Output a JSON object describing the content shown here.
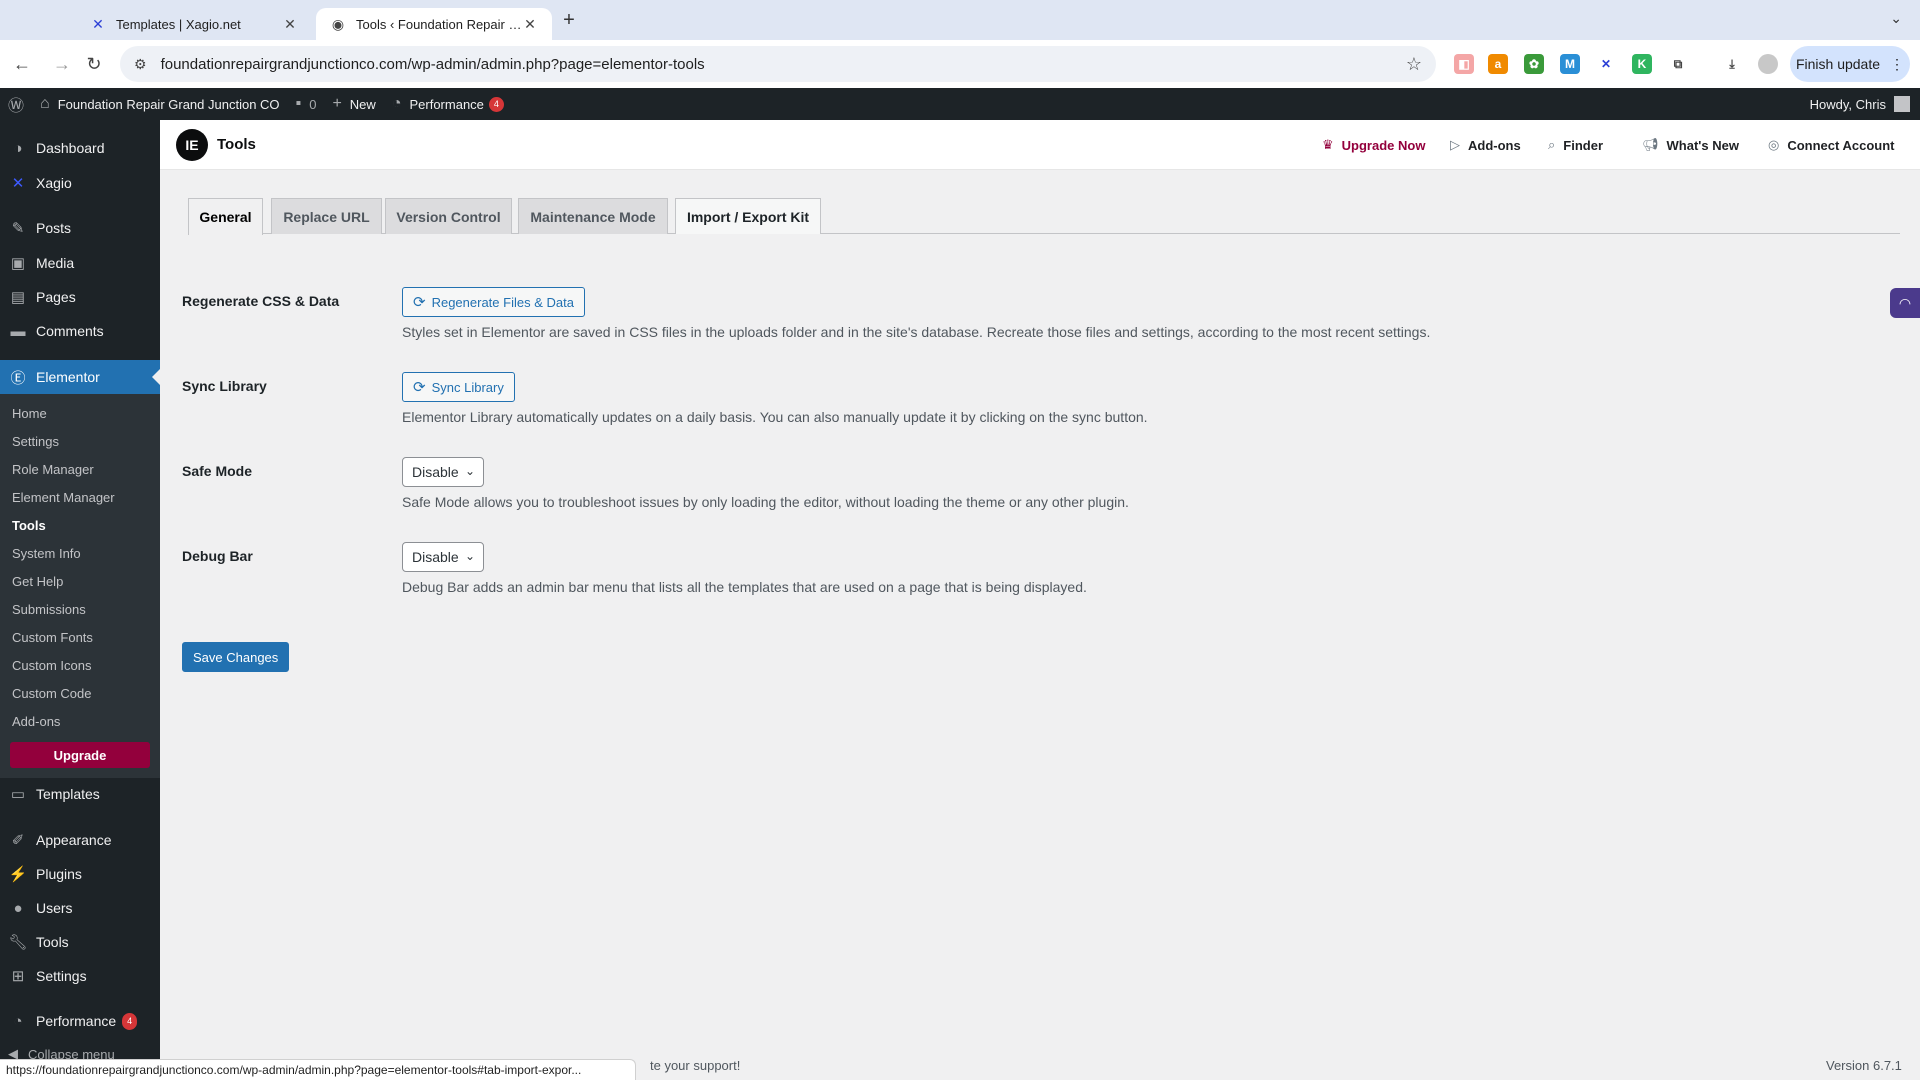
{
  "browser": {
    "tabs": [
      {
        "title": "Templates | Xagio.net",
        "icon": "xagio-icon"
      },
      {
        "title": "Tools ‹ Foundation Repair Gra",
        "icon": "wordpress-icon"
      }
    ],
    "url": "foundationrepairgrandjunctionco.com/wp-admin/admin.php?page=elementor-tools",
    "finish_update": "Finish update"
  },
  "adminbar": {
    "site_name": "Foundation Repair Grand Junction CO",
    "comments_count": "0",
    "new_label": "New",
    "performance_label": "Performance",
    "performance_badge": "4",
    "howdy": "Howdy, Chris"
  },
  "sidebar": {
    "items": [
      {
        "label": "Dashboard",
        "icon": "dashboard-icon"
      },
      {
        "label": "Xagio",
        "icon": "xagio-icon"
      },
      {
        "label": "Posts",
        "icon": "pin-icon"
      },
      {
        "label": "Media",
        "icon": "media-icon"
      },
      {
        "label": "Pages",
        "icon": "pages-icon"
      },
      {
        "label": "Comments",
        "icon": "comment-icon"
      },
      {
        "label": "Elementor",
        "icon": "elementor-icon"
      },
      {
        "label": "Templates",
        "icon": "folder-icon"
      },
      {
        "label": "Appearance",
        "icon": "brush-icon"
      },
      {
        "label": "Plugins",
        "icon": "plug-icon"
      },
      {
        "label": "Users",
        "icon": "user-icon"
      },
      {
        "label": "Tools",
        "icon": "wrench-icon"
      },
      {
        "label": "Settings",
        "icon": "settings-icon"
      },
      {
        "label": "Performance",
        "icon": "gauge-icon"
      }
    ],
    "performance_badge": "4",
    "submenu": [
      "Home",
      "Settings",
      "Role Manager",
      "Element Manager",
      "Tools",
      "System Info",
      "Get Help",
      "Submissions",
      "Custom Fonts",
      "Custom Icons",
      "Custom Code",
      "Add-ons"
    ],
    "upgrade": "Upgrade",
    "collapse": "Collapse menu"
  },
  "el_topbar": {
    "title": "Tools",
    "upgrade_now": "Upgrade Now",
    "addons": "Add-ons",
    "finder": "Finder",
    "whats_new": "What's New",
    "connect": "Connect Account"
  },
  "tabs": [
    "General",
    "Replace URL",
    "Version Control",
    "Maintenance Mode",
    "Import / Export Kit"
  ],
  "form": {
    "regen_label": "Regenerate CSS & Data",
    "regen_button": "Regenerate Files & Data",
    "regen_desc": "Styles set in Elementor are saved in CSS files in the uploads folder and in the site's database. Recreate those files and settings, according to the most recent settings.",
    "sync_label": "Sync Library",
    "sync_button": "Sync Library",
    "sync_desc": "Elementor Library automatically updates on a daily basis. You can also manually update it by clicking on the sync button.",
    "safe_label": "Safe Mode",
    "safe_value": "Disable",
    "safe_desc": "Safe Mode allows you to troubleshoot issues by only loading the editor, without loading the theme or any other plugin.",
    "debug_label": "Debug Bar",
    "debug_value": "Disable",
    "debug_desc": "Debug Bar adds an admin bar menu that lists all the templates that are used on a page that is being displayed.",
    "save": "Save Changes"
  },
  "footer": {
    "left": "te your support!",
    "version": "Version 6.7.1"
  },
  "statusbar": "https://foundationrepairgrandjunctionco.com/wp-admin/admin.php?page=elementor-tools#tab-import-expor..."
}
